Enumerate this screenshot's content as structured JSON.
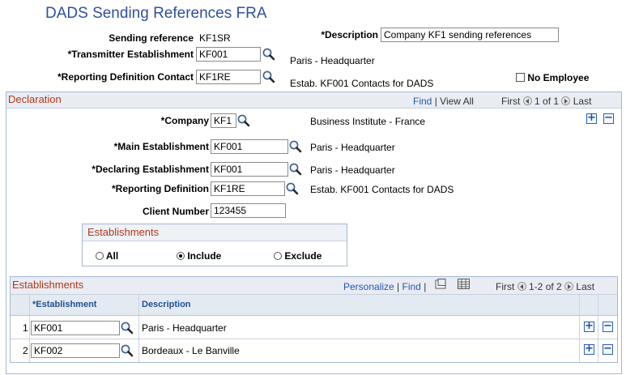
{
  "page": {
    "title": "DADS Sending References FRA"
  },
  "header": {
    "sending_reference_label": "Sending reference",
    "sending_reference_value": "KF1SR",
    "description_label": "*Description",
    "description_value": "Company KF1 sending references",
    "transmitter_label": "*Transmitter Establishment",
    "transmitter_value": "KF001",
    "transmitter_desc": "Paris - Headquarter",
    "reporting_contact_label": "*Reporting Definition Contact",
    "reporting_contact_value": "KF1RE",
    "reporting_contact_desc": "Estab. KF001 Contacts for DADS",
    "no_employee_label": "No Employee"
  },
  "declaration": {
    "title": "Declaration",
    "find": "Find",
    "sep": "|",
    "view_all": "View All",
    "first": "First",
    "counter": "1 of 1",
    "last": "Last",
    "company_label": "*Company",
    "company_value": "KF1",
    "company_desc": "Business Institute - France",
    "main_est_label": "*Main Establishment",
    "main_est_value": "KF001",
    "main_est_desc": "Paris - Headquarter",
    "declaring_label": "*Declaring Establishment",
    "declaring_value": "KF001",
    "declaring_desc": "Paris - Headquarter",
    "reporting_def_label": "*Reporting Definition",
    "reporting_def_value": "KF1RE",
    "reporting_def_desc": "Estab. KF001 Contacts for DADS",
    "client_number_label": "Client Number",
    "client_number_value": "123455",
    "establishments_group": {
      "title": "Establishments",
      "options": [
        "All",
        "Include",
        "Exclude"
      ],
      "selected": "Include"
    }
  },
  "grid": {
    "title": "Establishments",
    "personalize": "Personalize",
    "sep": "|",
    "find": "Find",
    "first": "First",
    "counter": "1-2 of 2",
    "last": "Last",
    "col_establishment": "*Establishment",
    "col_description": "Description",
    "rows": [
      {
        "num": "1",
        "establishment": "KF001",
        "description": "Paris - Headquarter"
      },
      {
        "num": "2",
        "establishment": "KF002",
        "description": "Bordeaux - Le Banville"
      }
    ]
  },
  "icons": {
    "lookup": "magnifier-icon",
    "add": "plus-icon",
    "delete": "minus-icon",
    "nav_prev": "left-arrow-icon",
    "nav_next": "right-arrow-icon",
    "zoom": "view-icon",
    "download": "download-icon"
  },
  "colors": {
    "title": "#2f4f9f",
    "section_title": "#b2391b",
    "link": "#2456b4",
    "border": "#a6b7cf"
  }
}
